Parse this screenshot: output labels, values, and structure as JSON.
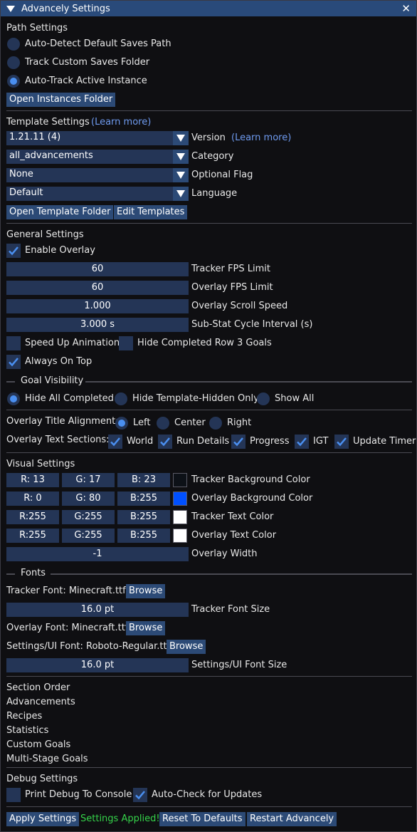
{
  "window": {
    "title": "Advancely Settings"
  },
  "path": {
    "header": "Path Settings",
    "options": [
      "Auto-Detect Default Saves Path",
      "Track Custom Saves Folder",
      "Auto-Track Active Instance"
    ],
    "selected_index": 2,
    "open_instances": "Open Instances Folder"
  },
  "template": {
    "header": "Template Settings",
    "learn_more": "(Learn more)",
    "version": {
      "value": "1.21.11 (4)",
      "label": "Version",
      "learn_more": "(Learn more)"
    },
    "category": {
      "value": "all_advancements",
      "label": "Category"
    },
    "optional_flag": {
      "value": "None",
      "label": "Optional Flag"
    },
    "language": {
      "value": "Default",
      "label": "Language"
    },
    "open_folder": "Open Template Folder",
    "edit": "Edit Templates"
  },
  "general": {
    "header": "General Settings",
    "enable_overlay": "Enable Overlay",
    "tracker_fps": {
      "value": "60",
      "label": "Tracker FPS Limit"
    },
    "overlay_fps": {
      "value": "60",
      "label": "Overlay FPS Limit"
    },
    "scroll_speed": {
      "value": "1.000",
      "label": "Overlay Scroll Speed"
    },
    "substat": {
      "value": "3.000 s",
      "label": "Sub-Stat Cycle Interval (s)"
    },
    "speed_up": "Speed Up Animation",
    "hide_row3": "Hide Completed Row 3 Goals",
    "always_on_top": "Always On Top",
    "checks": {
      "enable_overlay": true,
      "speed_up": false,
      "hide_row3": false,
      "always_on_top": true
    }
  },
  "goal_visibility": {
    "header": "Goal Visibility",
    "options": [
      "Hide All Completed",
      "Hide Template-Hidden Only",
      "Show All"
    ],
    "selected_index": 0
  },
  "overlay_title": {
    "label": "Overlay Title Alignment:",
    "options": [
      "Left",
      "Center",
      "Right"
    ],
    "selected_index": 0
  },
  "overlay_sections": {
    "label": "Overlay Text Sections:",
    "items": [
      "World",
      "Run Details",
      "Progress",
      "IGT",
      "Update Timer"
    ]
  },
  "visual": {
    "header": "Visual Settings",
    "rows": [
      {
        "r": "R: 13",
        "g": "G: 17",
        "b": "B: 23",
        "color": "#0d1117",
        "label": "Tracker Background Color"
      },
      {
        "r": "R:  0",
        "g": "G: 80",
        "b": "B:255",
        "color": "#0050ff",
        "label": "Overlay Background Color"
      },
      {
        "r": "R:255",
        "g": "G:255",
        "b": "B:255",
        "color": "#ffffff",
        "label": "Tracker Text Color"
      },
      {
        "r": "R:255",
        "g": "G:255",
        "b": "B:255",
        "color": "#ffffff",
        "label": "Overlay Text Color"
      }
    ],
    "overlay_width": {
      "value": "-1",
      "label": "Overlay Width"
    }
  },
  "fonts": {
    "header": "Fonts",
    "tracker_font": "Tracker Font: Minecraft.ttf",
    "browse": "Browse",
    "tracker_size": {
      "value": "16.0 pt",
      "label": "Tracker Font Size"
    },
    "overlay_font": "Overlay Font: Minecraft.ttf",
    "ui_font": "Settings/UI Font: Roboto-Regular.ttf",
    "ui_size": {
      "value": "16.0 pt",
      "label": "Settings/UI Font Size"
    }
  },
  "section_order": {
    "header": "Section Order",
    "items": [
      "Advancements",
      "Recipes",
      "Statistics",
      "Custom Goals",
      "Multi-Stage Goals"
    ]
  },
  "debug": {
    "header": "Debug Settings",
    "print_debug": "Print Debug To Console",
    "auto_check": "Auto-Check for Updates"
  },
  "footer": {
    "apply": "Apply Settings",
    "status": "Settings Applied!",
    "reset": "Reset To Defaults",
    "restart": "Restart Advancely"
  },
  "colors": {
    "accent": "#4a8ff0",
    "title_bar": "#294a7a",
    "button": "#2c4a76",
    "field": "#243556",
    "link": "#6f9bf0",
    "success": "#35d44a"
  }
}
